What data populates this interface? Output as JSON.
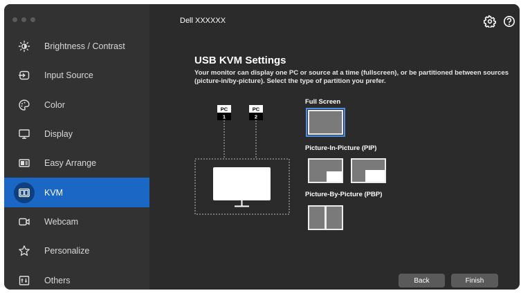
{
  "app": {
    "title": "Dell XXXXXX"
  },
  "sidebar": {
    "items": [
      {
        "label": "Brightness / Contrast",
        "icon": "brightness-icon",
        "active": false
      },
      {
        "label": "Input Source",
        "icon": "input-source-icon",
        "active": false
      },
      {
        "label": "Color",
        "icon": "color-palette-icon",
        "active": false
      },
      {
        "label": "Display",
        "icon": "display-icon",
        "active": false
      },
      {
        "label": "Easy Arrange",
        "icon": "easy-arrange-icon",
        "active": false
      },
      {
        "label": "KVM",
        "icon": "kvm-icon",
        "active": true
      },
      {
        "label": "Webcam",
        "icon": "webcam-icon",
        "active": false
      },
      {
        "label": "Personalize",
        "icon": "star-icon",
        "active": false
      },
      {
        "label": "Others",
        "icon": "others-icon",
        "active": false
      }
    ]
  },
  "main": {
    "heading": "USB KVM Settings",
    "description": "Your monitor can display one PC or source at a time (fullscreen), or be partitioned between sources (picture-in/by-picture). Select the type of partition you prefer.",
    "diagram": {
      "pc1_top": "PC",
      "pc1_bottom": "1",
      "pc2_top": "PC",
      "pc2_bottom": "2"
    },
    "options": {
      "full_screen": "Full Screen",
      "pip": "Picture-In-Picture (PIP)",
      "pbp": "Picture-By-Picture (PBP)"
    },
    "selected_option": "full_screen",
    "buttons": {
      "back": "Back",
      "finish": "Finish"
    }
  },
  "colors": {
    "accent": "#1a67c6",
    "sidebar_bg": "#323232",
    "main_bg": "#2b2b2b",
    "button_bg": "#5a5a5a"
  }
}
